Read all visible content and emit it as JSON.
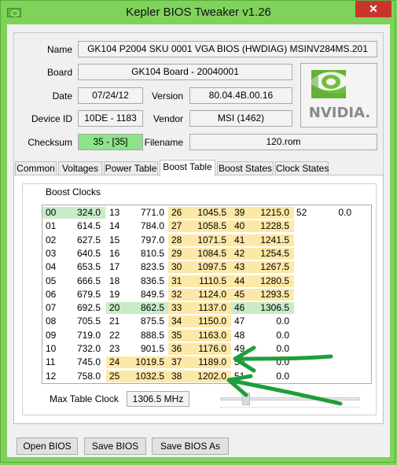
{
  "window": {
    "title": "Kepler BIOS Tweaker v1.26",
    "close_glyph": "✕"
  },
  "info": {
    "name_label": "Name",
    "name_value": "GK104 P2004 SKU 0001 VGA BIOS (HWDIAG) MSINV284MS.201",
    "board_label": "Board",
    "board_value": "GK104 Board - 20040001",
    "date_label": "Date",
    "date_value": "07/24/12",
    "version_label": "Version",
    "version_value": "80.04.4B.00.16",
    "device_label": "Device ID",
    "device_value": "10DE - 1183",
    "vendor_label": "Vendor",
    "vendor_value": "MSI (1462)",
    "checksum_label": "Checksum",
    "checksum_value": "35 - [35]",
    "filename_label": "Filename",
    "filename_value": "120.rom",
    "logo_text": "NVIDIA."
  },
  "tabs": [
    "Common",
    "Voltages",
    "Power Table",
    "Boost Table",
    "Boost States",
    "Clock States"
  ],
  "active_tab": "Boost Table",
  "boost": {
    "group_title": "Boost Clocks",
    "columns": [
      [
        [
          "00",
          "324.0"
        ],
        [
          "01",
          "614.5"
        ],
        [
          "02",
          "627.5"
        ],
        [
          "03",
          "640.5"
        ],
        [
          "04",
          "653.5"
        ],
        [
          "05",
          "666.5"
        ],
        [
          "06",
          "679.5"
        ],
        [
          "07",
          "692.5"
        ],
        [
          "08",
          "705.5"
        ],
        [
          "09",
          "719.0"
        ],
        [
          "10",
          "732.0"
        ],
        [
          "11",
          "745.0"
        ],
        [
          "12",
          "758.0"
        ]
      ],
      [
        [
          "13",
          "771.0"
        ],
        [
          "14",
          "784.0"
        ],
        [
          "15",
          "797.0"
        ],
        [
          "16",
          "810.5"
        ],
        [
          "17",
          "823.5"
        ],
        [
          "18",
          "836.5"
        ],
        [
          "19",
          "849.5"
        ],
        [
          "20",
          "862.5"
        ],
        [
          "21",
          "875.5"
        ],
        [
          "22",
          "888.5"
        ],
        [
          "23",
          "901.5"
        ],
        [
          "24",
          "1019.5"
        ],
        [
          "25",
          "1032.5"
        ]
      ],
      [
        [
          "26",
          "1045.5"
        ],
        [
          "27",
          "1058.5"
        ],
        [
          "28",
          "1071.5"
        ],
        [
          "29",
          "1084.5"
        ],
        [
          "30",
          "1097.5"
        ],
        [
          "31",
          "1110.5"
        ],
        [
          "32",
          "1124.0"
        ],
        [
          "33",
          "1137.0"
        ],
        [
          "34",
          "1150.0"
        ],
        [
          "35",
          "1163.0"
        ],
        [
          "36",
          "1176.0"
        ],
        [
          "37",
          "1189.0"
        ],
        [
          "38",
          "1202.0"
        ]
      ],
      [
        [
          "39",
          "1215.0"
        ],
        [
          "40",
          "1228.5"
        ],
        [
          "41",
          "1241.5"
        ],
        [
          "42",
          "1254.5"
        ],
        [
          "43",
          "1267.5"
        ],
        [
          "44",
          "1280.5"
        ],
        [
          "45",
          "1293.5"
        ],
        [
          "46",
          "1306.5"
        ],
        [
          "47",
          "0.0"
        ],
        [
          "48",
          "0.0"
        ],
        [
          "49",
          "0.0"
        ],
        [
          "50",
          "0.0"
        ],
        [
          "51",
          "0.0"
        ]
      ],
      [
        [
          "52",
          "0.0"
        ]
      ]
    ],
    "max_label": "Max Table Clock",
    "max_value": "1306.5 MHz"
  },
  "buttons": {
    "open": "Open BIOS",
    "save": "Save BIOS",
    "save_as": "Save BIOS As"
  },
  "colors": {
    "window_frame": "#7fd35b",
    "checksum_ok": "#8de38a",
    "boost_highlight": "#fde8a7",
    "selected_highlight": "#c9ecc8",
    "annotation_arrow": "#1e9e3a"
  }
}
